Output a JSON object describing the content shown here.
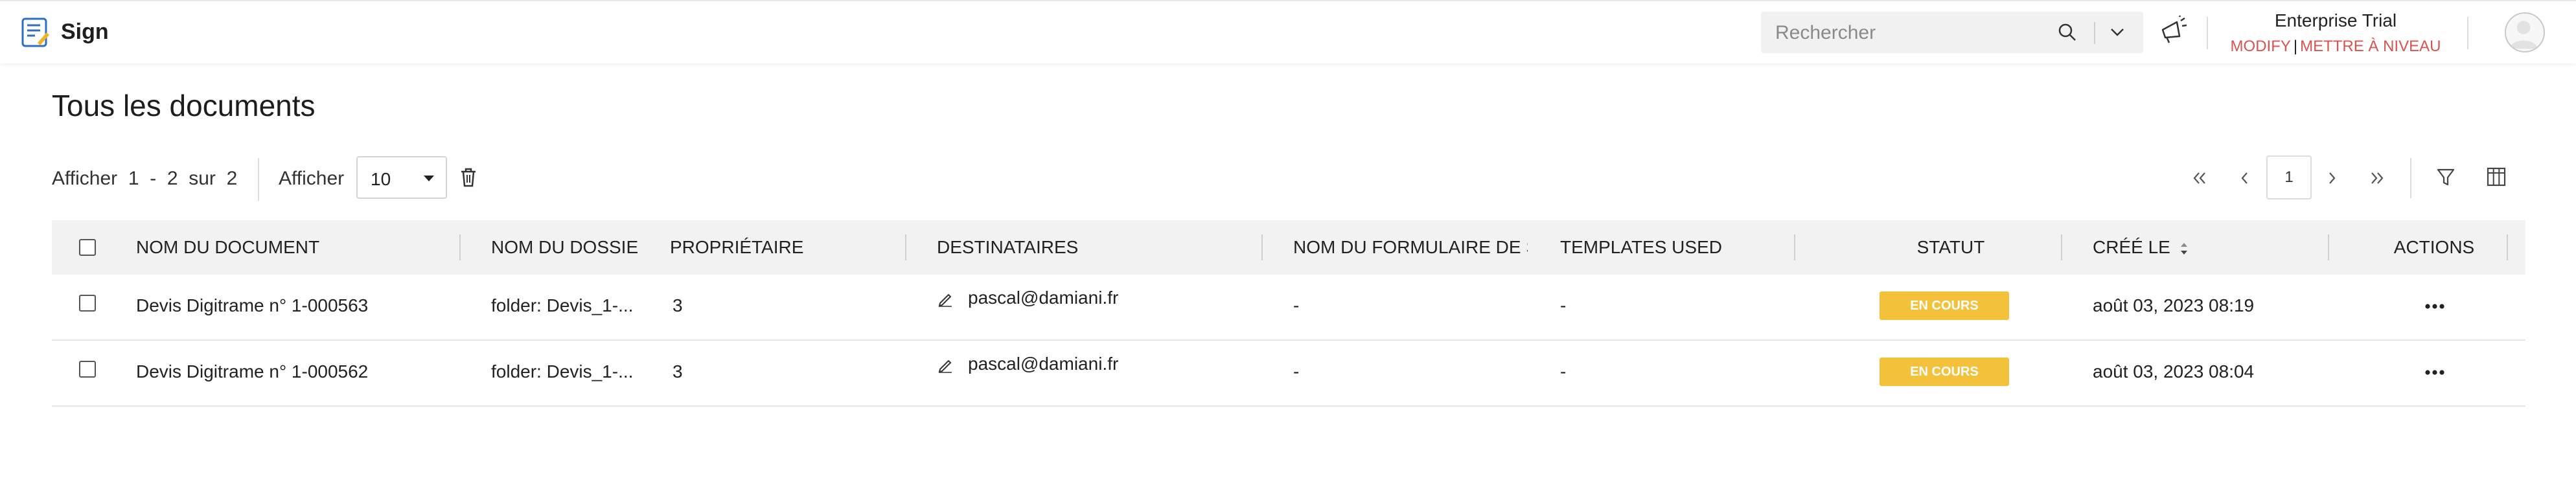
{
  "app": {
    "title": "Sign"
  },
  "search": {
    "placeholder": "Rechercher"
  },
  "plan": {
    "name": "Enterprise Trial",
    "modify_label": "MODIFY",
    "separator": "|",
    "upgrade_label": "METTRE À NIVEAU",
    "link_color": "#d9534f"
  },
  "page": {
    "title": "Tous les documents"
  },
  "toolbar": {
    "showing_label": "Afficher",
    "range_start": "1",
    "range_dash": "-",
    "range_end": "2",
    "of_label": "sur",
    "total": "2",
    "show_label": "Afficher",
    "page_size": "10"
  },
  "pagination": {
    "current_page": "1"
  },
  "table": {
    "columns": [
      "NOM DU DOCUMENT",
      "NOM DU DOSSIER",
      "PROPRIÉTAIRE",
      "DESTINATAIRES",
      "NOM DU FORMULAIRE DE SIGNATURE",
      "TEMPLATES USED",
      "STATUT",
      "CRÉÉ LE",
      "ACTIONS"
    ],
    "rows": [
      {
        "document": "Devis Digitrame n° 1-000563",
        "folder": "folder: Devis_1-...",
        "owner": "3",
        "recipient": "pascal@damiani.fr",
        "form": "-",
        "templates": "-",
        "status": "EN COURS",
        "created": "août 03, 2023 08:19"
      },
      {
        "document": "Devis Digitrame n° 1-000562",
        "folder": "folder: Devis_1-...",
        "owner": "3",
        "recipient": "pascal@damiani.fr",
        "form": "-",
        "templates": "-",
        "status": "EN COURS",
        "created": "août 03, 2023 08:04"
      }
    ]
  },
  "colors": {
    "status_in_progress": "#f3c13a",
    "header_bg": "#f2f2f2",
    "logo_accent": "#f0b429",
    "logo_blue": "#2d6fc6"
  },
  "icons": {
    "logo": "sign-logo-icon",
    "search": "search-icon",
    "dropdown": "chevron-down-icon",
    "promo": "megaphone-icon",
    "delete": "trash-icon",
    "filter": "filter-icon",
    "columns": "columns-icon",
    "recipient": "pen-icon",
    "actions": "more-horizontal-icon"
  }
}
